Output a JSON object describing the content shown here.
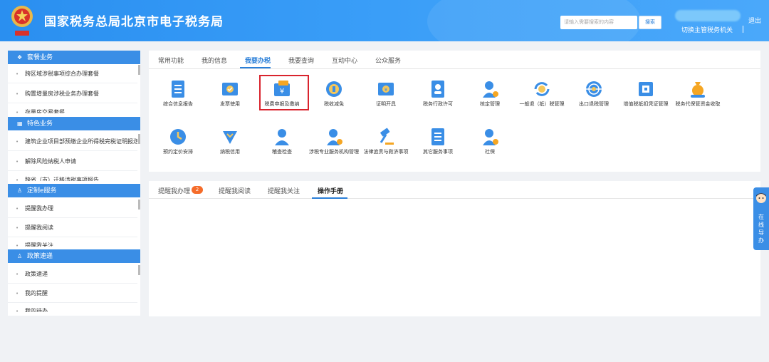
{
  "header": {
    "site_title": "国家税务总局北京市电子税务局",
    "search_placeholder": "请输入需要搜索的内容",
    "search_button": "搜索",
    "logout": "退出",
    "switch_org": "切换主管税务机关",
    "brand_color": "#3a9ef8"
  },
  "sidebar": {
    "sections": [
      {
        "title": "套餐业务",
        "icon": "layers-icon",
        "items": [
          "跨区域涉税事项综合办理套餐",
          "购置增量房涉税业务办理套餐",
          "存量房交易套餐"
        ]
      },
      {
        "title": "特色业务",
        "icon": "grid-icon",
        "items": [
          "建筑企业项目部预缴企业所得税完税证明报送",
          "解除风险纳税人申请",
          "跨省（市）迁移涉税事项报告"
        ]
      },
      {
        "title": "定制e服务",
        "icon": "user-icon",
        "items": [
          "提醒我办理",
          "提醒我阅读",
          "提醒我关注"
        ]
      },
      {
        "title": "政策速递",
        "icon": "user-icon",
        "items": [
          "政策速递",
          "我的提醒",
          "我的待办"
        ]
      }
    ]
  },
  "main_tabs": [
    "常用功能",
    "我的信息",
    "我要办税",
    "我要查询",
    "互动中心",
    "公众服务"
  ],
  "main_tabs_active": "我要办税",
  "functions": [
    {
      "label": "综合信息报告",
      "icon": "document-icon"
    },
    {
      "label": "发票使用",
      "icon": "invoice-icon"
    },
    {
      "label": "税费申报及缴纳",
      "icon": "tax-payment-icon"
    },
    {
      "label": "税收减免",
      "icon": "coin-icon"
    },
    {
      "label": "证明开具",
      "icon": "certificate-icon"
    },
    {
      "label": "税务行政许可",
      "icon": "permit-icon"
    },
    {
      "label": "核定管理",
      "icon": "user-gear-icon"
    },
    {
      "label": "一般退（抵）税管理",
      "icon": "refund-icon"
    },
    {
      "label": "出口退税管理",
      "icon": "globe-icon"
    },
    {
      "label": "增值税抵扣凭证管理",
      "icon": "voucher-icon"
    },
    {
      "label": "税务代保管资金收取",
      "icon": "money-bag-icon"
    },
    {
      "label": "预约定价安排",
      "icon": "clock-icon"
    },
    {
      "label": "纳税信用",
      "icon": "shield-icon"
    },
    {
      "label": "稽查检查",
      "icon": "inspector-icon"
    },
    {
      "label": "涉税专业服务机构管理",
      "icon": "agency-icon"
    },
    {
      "label": "法律追责与救济事项",
      "icon": "gavel-icon"
    },
    {
      "label": "其它服务事项",
      "icon": "list-icon"
    },
    {
      "label": "社保",
      "icon": "social-security-icon"
    }
  ],
  "remind_tabs": [
    "提醒我办理",
    "提醒我阅读",
    "提醒我关注",
    "操作手册"
  ],
  "remind_tabs_active": "操作手册",
  "remind_badge": "2",
  "online_guide": {
    "label": "在线导办"
  }
}
